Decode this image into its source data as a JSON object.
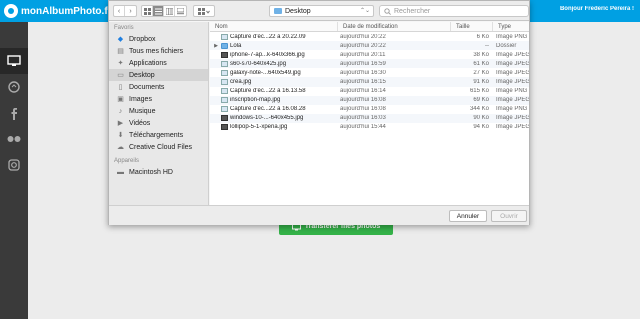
{
  "site": {
    "logo_text": "monAlbumPhoto.fr",
    "greeting": "Bonjour Frederic Pereira !",
    "upload_button": "Transférer mes photos",
    "accent": "#00a0e3"
  },
  "dialog": {
    "location": "Desktop",
    "search_placeholder": "Rechercher",
    "sidebar": {
      "favorites_heading": "Favoris",
      "favorites": [
        {
          "label": "Dropbox",
          "icon": "dropbox-icon"
        },
        {
          "label": "Tous mes fichiers",
          "icon": "all-files-icon"
        },
        {
          "label": "Applications",
          "icon": "applications-icon"
        },
        {
          "label": "Desktop",
          "icon": "desktop-icon",
          "selected": true
        },
        {
          "label": "Documents",
          "icon": "documents-icon"
        },
        {
          "label": "Images",
          "icon": "images-icon"
        },
        {
          "label": "Musique",
          "icon": "music-icon"
        },
        {
          "label": "Vidéos",
          "icon": "videos-icon"
        },
        {
          "label": "Téléchargements",
          "icon": "downloads-icon"
        },
        {
          "label": "Creative Cloud Files",
          "icon": "creative-cloud-icon"
        }
      ],
      "devices_heading": "Appareils",
      "devices": [
        {
          "label": "Macintosh HD",
          "icon": "hard-drive-icon"
        }
      ]
    },
    "columns": {
      "name": "Nom",
      "date": "Date de modification",
      "size": "Taille",
      "type": "Type"
    },
    "files": [
      {
        "name": "Capture d'éc...22 à 20.22.09",
        "date": "aujourd'hui 20:22",
        "size": "6 Ko",
        "type": "Image PNG",
        "kind": "img"
      },
      {
        "name": "Lola",
        "date": "aujourd'hui 20:22",
        "size": "--",
        "type": "Dossier",
        "kind": "folder"
      },
      {
        "name": "iphone-7-ap...k-640x366.jpg",
        "date": "aujourd'hui 20:11",
        "size": "38 Ko",
        "type": "Image JPEG",
        "kind": "dark"
      },
      {
        "name": "s60-s70-640x425.jpg",
        "date": "aujourd'hui 16:59",
        "size": "61 Ko",
        "type": "Image JPEG",
        "kind": "img"
      },
      {
        "name": "galaxy-note-...640x549.jpg",
        "date": "aujourd'hui 16:30",
        "size": "27 Ko",
        "type": "Image JPEG",
        "kind": "img"
      },
      {
        "name": "crea.jpg",
        "date": "aujourd'hui 16:15",
        "size": "91 Ko",
        "type": "Image JPEG",
        "kind": "img"
      },
      {
        "name": "Capture d'éc...22 à 16.13.58",
        "date": "aujourd'hui 16:14",
        "size": "615 Ko",
        "type": "Image PNG",
        "kind": "img"
      },
      {
        "name": "inscription-map.jpg",
        "date": "aujourd'hui 16:08",
        "size": "69 Ko",
        "type": "Image JPEG",
        "kind": "img"
      },
      {
        "name": "Capture d'éc...22 à 16.08.28",
        "date": "aujourd'hui 16:08",
        "size": "344 Ko",
        "type": "Image PNG",
        "kind": "img"
      },
      {
        "name": "windows-10-...-640x455.jpg",
        "date": "aujourd'hui 16:03",
        "size": "90 Ko",
        "type": "Image JPEG",
        "kind": "dark"
      },
      {
        "name": "lollipop-5-1-xperia.jpg",
        "date": "aujourd'hui 15:44",
        "size": "94 Ko",
        "type": "Image JPEG",
        "kind": "dark"
      }
    ],
    "cancel_label": "Annuler",
    "open_label": "Ouvrir"
  }
}
